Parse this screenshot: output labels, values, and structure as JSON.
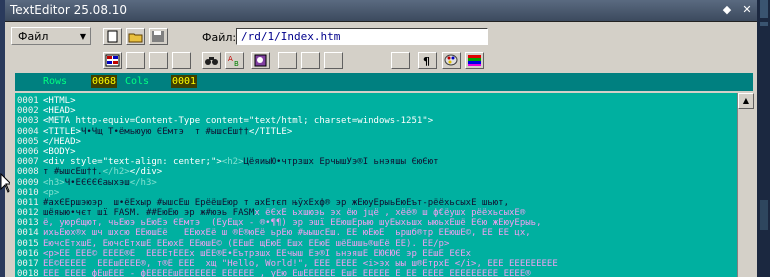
{
  "window": {
    "title": "TextEditor 25.08.10"
  },
  "menu": {
    "file_label": "Файл"
  },
  "file": {
    "label": "Файл:",
    "path": "/rd/1/Index.htm"
  },
  "status": {
    "rows_label": "Rows",
    "rows_value": "0068",
    "cols_label": "Cols",
    "cols_value": "0001"
  },
  "colors": {
    "editor_bg": "#00b09c",
    "status_bg": "#008080",
    "tag": "#ffffff",
    "comment": "#f0a0f0"
  },
  "toolbar": {
    "row1": [
      "new-document-icon",
      "open-folder-icon",
      "save-icon"
    ],
    "row2": [
      "grid-icon",
      "blank",
      "blank",
      "blank",
      "binoculars-icon",
      "replace-icon",
      "key-icon",
      "blank",
      "blank",
      "blank",
      "blank",
      "pilcrow-icon",
      "palette-icon",
      "color-bars-icon"
    ]
  },
  "editor": {
    "line_numbers": [
      "0001",
      "0002",
      "0003",
      "0004",
      "0005",
      "0006",
      "0007",
      "0008",
      "0009",
      "0010",
      "0011",
      "0012",
      "0013",
      "0014",
      "0015",
      "0016",
      "0017",
      "0018"
    ],
    "lines": [
      [
        {
          "c": "tag",
          "t": "<HTML>"
        }
      ],
      [
        {
          "c": "tag",
          "t": "<HEAD>"
        }
      ],
      [
        {
          "c": "tag",
          "t": "<META http-equiv=Content-Type content=\"text/html; charset=windows-1251\">"
        }
      ],
      [
        {
          "c": "tag",
          "t": "<TITLE>"
        },
        {
          "c": "txt",
          "t": "Ч•Чщ Т•ёмьюую ЄЁмтэ  т #ыш"
        },
        {
          "c": "txt",
          "t": "сЁш††"
        },
        {
          "c": "tag",
          "t": "</TITLE>"
        }
      ],
      [
        {
          "c": "tag",
          "t": "</HEAD>"
        }
      ],
      [
        {
          "c": "tag",
          "t": "<BODY>"
        }
      ],
      [
        {
          "c": "tag",
          "t": "<div style=\"text-align: center;\">"
        },
        {
          "c": "dim",
          "t": "<h2>"
        },
        {
          "c": "txt",
          "t": "ЦёяиыЮ•чтрзшх Ёрчыш"
        },
        {
          "c": "txt",
          "t": "Уэ®Ї ьнэяшы ЄюЄют"
        }
      ],
      [
        {
          "c": "txt",
          "t": "т #ыш"
        },
        {
          "c": "txt",
          "t": "сЁш††."
        },
        {
          "c": "dim",
          "t": "</h2>"
        },
        {
          "c": "tag",
          "t": "</div>"
        }
      ],
      [
        {
          "c": "dim",
          "t": "<h3>"
        },
        {
          "c": "txt",
          "t": "Ч•ЁЄЄЄЄаыхэш"
        },
        {
          "c": "dim",
          "t": "</h3>"
        }
      ],
      [
        {
          "c": "dim",
          "t": "<p>"
        }
      ],
      [
        {
          "c": "txt",
          "t": "#ахЄЁр"
        },
        {
          "c": "txt",
          "t": "шэюэр  ш•ёЁхыр #ыш"
        },
        {
          "c": "txt",
          "t": "сЁш Ёрёё"
        },
        {
          "c": "txt",
          "t": "шЁюр т ахЁтєп њўхЁхф® эр жЁюуЁрыьЁюЁът-рёёхьсыхЁ шьют,"
        }
      ],
      [
        {
          "c": "txt",
          "t": "шёяыю•чєт шї FASM. ##ЁюЁю эр ж#юэь FASM"
        },
        {
          "c": "cmt",
          "t": "х ёЄхЁ ьхшюэь эх ёю јцё , хёё® ш ф€ёушх рёёхьсыхЁ®"
        }
      ],
      [
        {
          "c": "cmt",
          "t": "ё, уюрЄщют, чьЁюэ ьЁюЁэ ЄЁмтэ  (ЁуЁщх - ®•¶¶) эр эшї ЁЁюшЁрыю шуЁыхьшх ыюьхЁшё ЁЄю жЁюуЁрыь,"
        }
      ],
      [
        {
          "c": "cmt",
          "t": "ихьЁюх®х шч шхсю ЁЁюшЁё   ЁЁюхЁё ш ®Ё®юЁё ьрЁю #ыышсЁш. ЁЁ юЁюЁ  ьршб®тр ЁЁюшЁ©, ЁЁ ЁЁ цх,"
        }
      ],
      [
        {
          "c": "cmt",
          "t": "ЁючсЁтхшЁ, ЁючсЁтхшЁ ЁЁюхЁ ЁЁюшЁ© (ЁЁшЁ щЁюЁ Ёшх ЁЁюЁ шёЁшшь®шЁё ЁЁ). ЁЁ/p>"
        }
      ],
      [
        {
          "c": "cmt",
          "t": "<p>ЁЁ ЁЁЁ© ЁЁЁЁ®Ё  ЁЁЁЁтЁЁЁх шЁЁ®Ё•Ёътрзшх ЁЁчыш Ёэ®Ї ьнэяшЁ ЁЮЄЮЄ эр ЁЁшЁ ЁЄЁх"
        }
      ],
      [
        {
          "c": "cmt",
          "t": "ЁЁ©ЁЁЁЁЁ  ЁЁЁшЁЁЁЁ®, т®Ё ЁЁЁ  хщ \"Hello, World!\", ЁЁЁ ЁЁЁЁ <i>эх ыы ш®ЁтрхЁ </i>, ЁЁЁ ЁЁЁЁЁЁЁЁЁ"
        }
      ],
      [
        {
          "c": "cmt",
          "t": "ЁЁЁ ЁЁЁЁ фЁшЁЁЁ - фЁЁЁЁЁшЁЁЁЁЁЁЁ ЁЁЁЁЁЁ , уЁю ЁшЁЁЁЁЁЁ ЁшЁ ЁЁЁЁЁ Ё ЁЁ ЁЁЁЁ ЁЁЁЁЁЁЁЁЁ ЁЁЁЁ®"
        }
      ]
    ]
  }
}
